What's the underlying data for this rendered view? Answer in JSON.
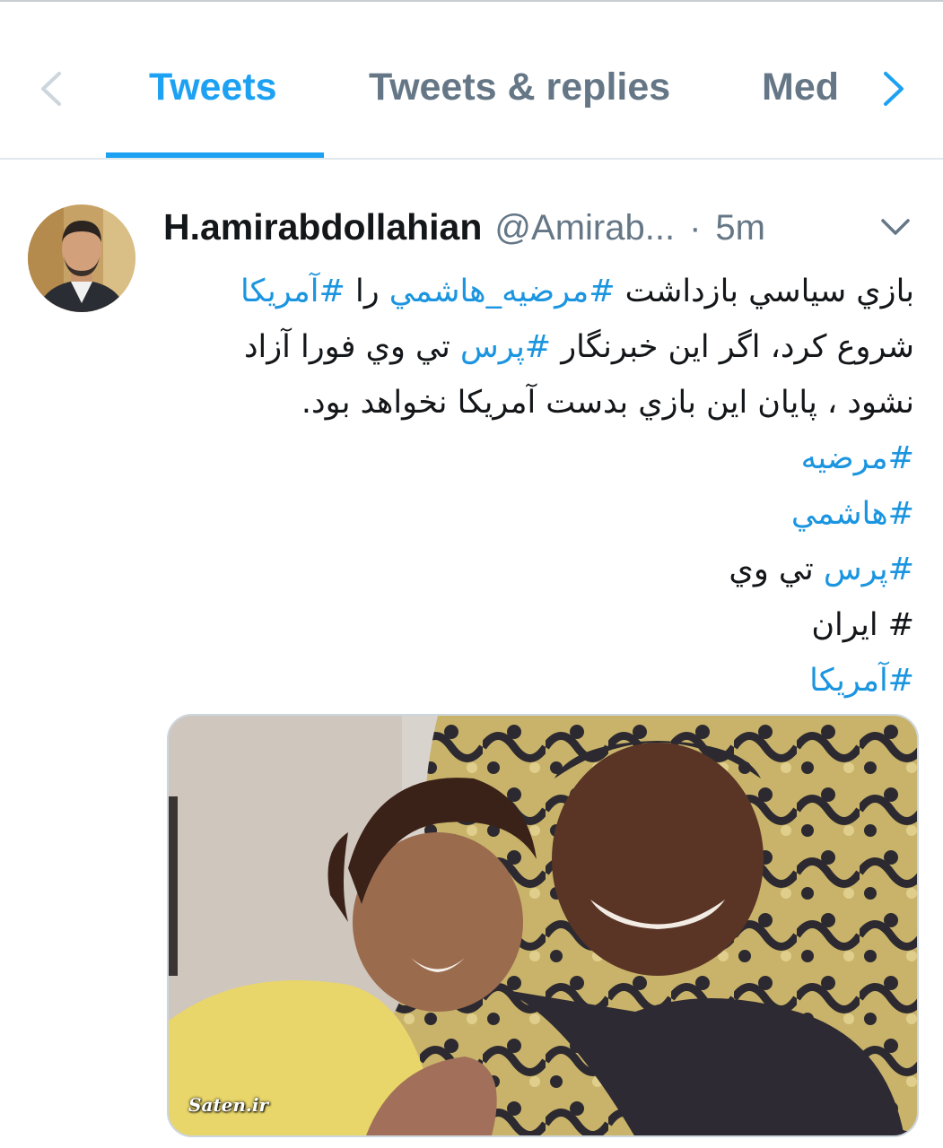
{
  "tabs": {
    "items": [
      {
        "label": "Tweets",
        "active": true
      },
      {
        "label": "Tweets & replies",
        "active": false
      },
      {
        "label": "Med",
        "active": false
      }
    ],
    "prev_icon": "chevron-left-icon",
    "next_icon": "chevron-right-icon",
    "active_color": "#1da1f2",
    "inactive_color": "#657786"
  },
  "tweet": {
    "author_name": "H.amirabdollahian",
    "author_handle": "@Amirab...",
    "separator": "·",
    "timestamp": "5m",
    "menu_icon": "chevron-down-icon",
    "hashtag_color": "#1b95e0",
    "text": {
      "l1_pre": "بازي سياسي بازداشت ",
      "l1_tag1": "#مرضيه_هاشمي",
      "l1_mid": " را ",
      "l1_tag2": "#آمريكا",
      "l2_pre": "شروع كرد، اگر اين خبرنگار ",
      "l2_tag": "#پرس",
      "l2_post": " تي وي فورا آزاد",
      "l3": "نشود ، پايان اين بازي بدست آمريكا نخواهد بود.",
      "l4_tag": "#مرضيه",
      "l5_tag": "#هاشمي",
      "l6_tag": "#پرس",
      "l6_post": " تي وي",
      "l7": "# ايران",
      "l8_tag": "#آمريكا"
    },
    "media": {
      "watermark": "Saten.ir"
    }
  }
}
